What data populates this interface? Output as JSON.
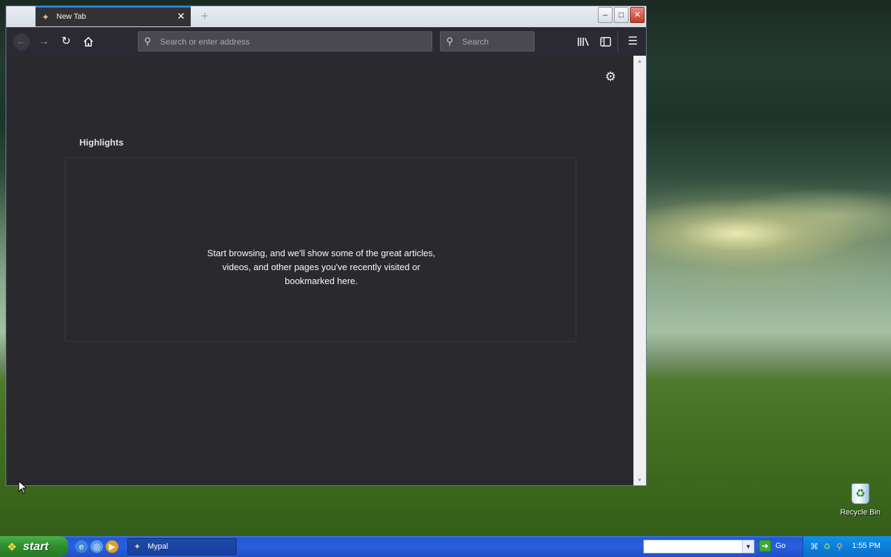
{
  "browser": {
    "tab": {
      "title": "New Tab",
      "close_label": "✕"
    },
    "new_tab_label": "+",
    "window_controls": {
      "minimize": "–",
      "maximize": "□",
      "close": "✕"
    },
    "nav": {
      "back_icon": "arrow-left-icon",
      "forward_icon": "arrow-right-icon",
      "reload_icon": "reload-icon",
      "home_icon": "home-icon"
    },
    "url_placeholder": "Search or enter address",
    "search_placeholder": "Search",
    "toolbar_icons": [
      "library-icon",
      "sidebar-icon",
      "hamburger-menu-icon"
    ],
    "content": {
      "highlights_title": "Highlights",
      "highlights_message": "Start browsing, and we'll show some of the great articles, videos, and other pages you've recently visited or bookmarked here."
    },
    "theme_colors": {
      "content_bg": "#2a2a2e",
      "toolbar_bg": "#2b2a33",
      "accent": "#0a84ff"
    }
  },
  "desktop": {
    "recycle_bin_label": "Recycle Bin"
  },
  "taskbar": {
    "start_label": "start",
    "quick_launch": [
      "internet-explorer-icon",
      "explorer-icon",
      "media-player-icon"
    ],
    "tasks": [
      {
        "label": "Mypal"
      }
    ],
    "address_value": "",
    "go_label": "Go",
    "clock": "1:55 PM"
  }
}
